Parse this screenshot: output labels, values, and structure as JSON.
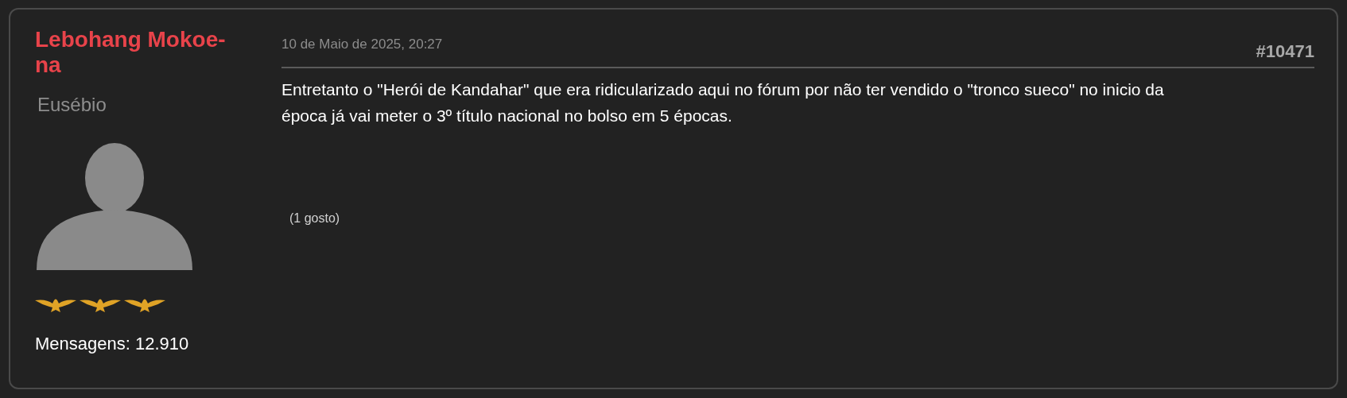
{
  "post": {
    "author": {
      "name": "Lebohang Mokoe-na",
      "rank": "Eusébio",
      "message_count": "Mensagens: 12.910"
    },
    "date": "10 de Maio de 2025, 20:27",
    "number": "#10471",
    "body": "Entretanto o \"Herói de Kandahar\" que era ridicularizado aqui no fórum por não ter vendido o \"tronco sueco\" no inicio da época já vai meter o 3º título nacional no bolso em 5 épocas.",
    "likes": "(1 gosto)"
  }
}
